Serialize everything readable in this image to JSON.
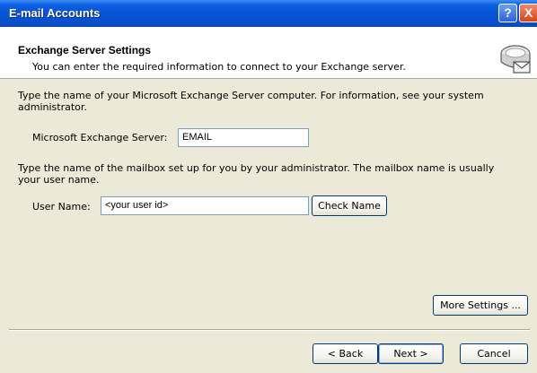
{
  "window": {
    "title": "E-mail Accounts",
    "help_glyph": "?",
    "close_glyph": "X"
  },
  "header": {
    "title": "Exchange Server Settings",
    "subtitle": "You can enter the required information to connect to your Exchange server."
  },
  "server_section": {
    "instruction_line1": "Type the name of your Microsoft Exchange Server computer. For information, see your system",
    "instruction_line2": "administrator.",
    "label": "Microsoft Exchange Server:",
    "value": "EMAIL"
  },
  "user_section": {
    "instruction_line1": "Type the name of the mailbox set up for you by your administrator. The mailbox name is usually",
    "instruction_line2": "your user name.",
    "label": "User Name:",
    "value": "<your user id>",
    "check_name_label": "Check Name"
  },
  "more_settings_label": "More Settings ...",
  "footer": {
    "back_label": "< Back",
    "next_label": "Next >",
    "cancel_label": "Cancel"
  },
  "icons": {
    "header_icon": "mail-server-icon"
  }
}
